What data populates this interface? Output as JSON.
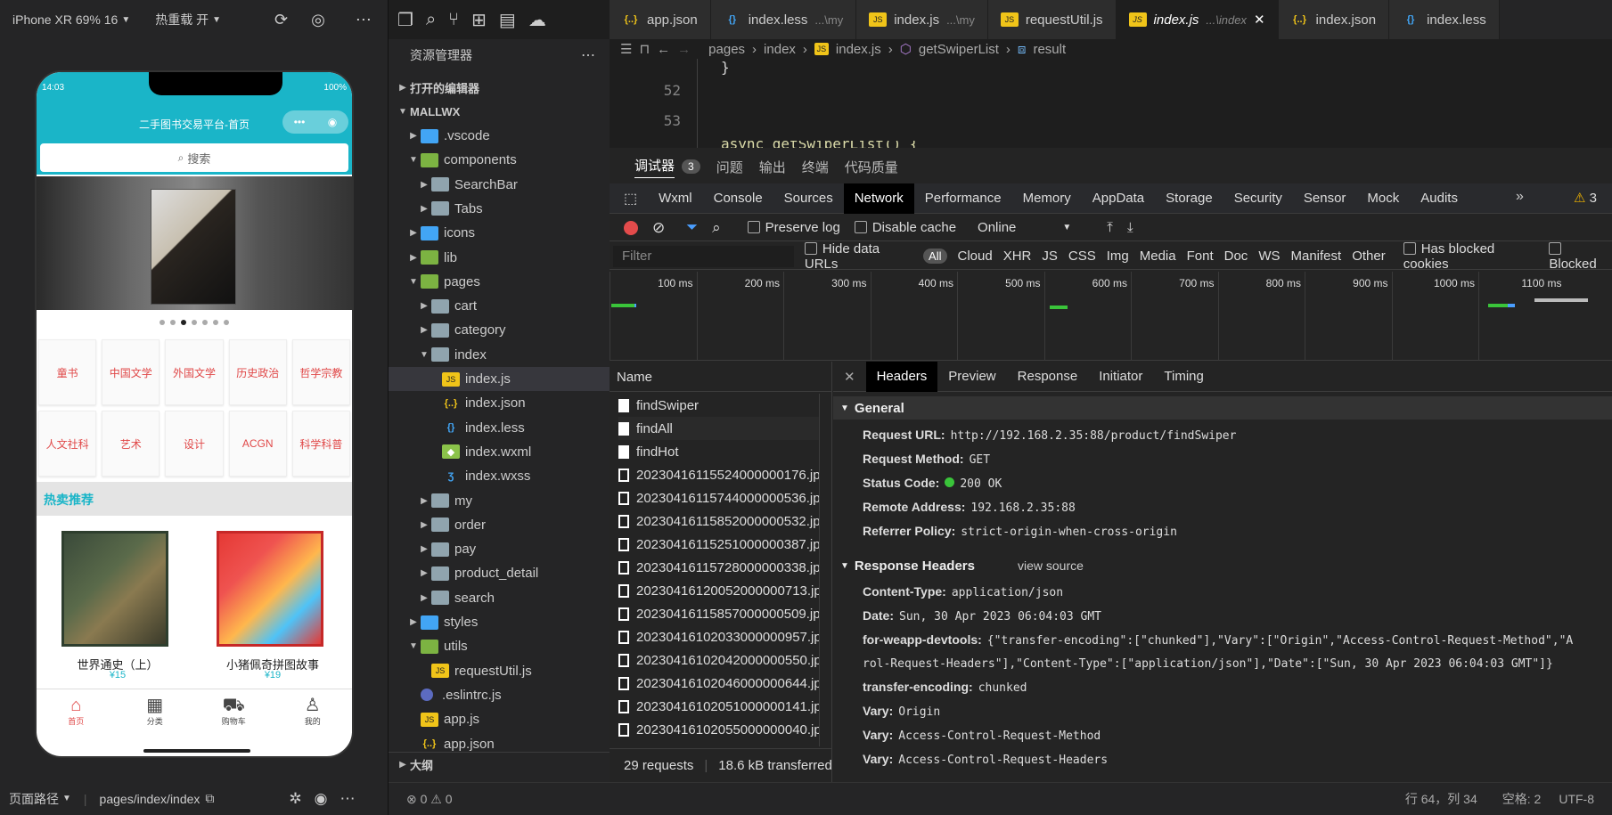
{
  "simulator": {
    "device": "iPhone XR 69% 16",
    "hot_reload": "热重载 开",
    "bottom": {
      "path_label": "页面路径",
      "path": "pages/index/index"
    },
    "phone": {
      "time": "14:03",
      "battery": "100%",
      "nav_title": "二手图书交易平台-首页",
      "capsule_more": "•••",
      "capsule_close": "◉",
      "search": "搜索",
      "swiper_dots": 7,
      "swiper_active_index": 3,
      "categories": [
        "童书",
        "中国文学",
        "外国文学",
        "历史政治",
        "哲学宗教",
        "人文社科",
        "艺术",
        "设计",
        "ACGN",
        "科学科普"
      ],
      "hot_title": "热卖推荐",
      "products": [
        {
          "name": "世界通史（上）",
          "price": "¥15"
        },
        {
          "name": "小猪佩奇拼图故事",
          "price": "¥19"
        }
      ],
      "tabbar": [
        {
          "label": "首页",
          "icon": "home-icon",
          "active": true
        },
        {
          "label": "分类",
          "icon": "category-icon",
          "active": false
        },
        {
          "label": "购物车",
          "icon": "cart-icon",
          "active": false
        },
        {
          "label": "我的",
          "icon": "user-icon",
          "active": false
        }
      ]
    }
  },
  "explorer": {
    "title": "资源管理器",
    "open_editors": "打开的编辑器",
    "project": "MALLWX",
    "outline": "大纲",
    "tree": [
      {
        "label": ".vscode",
        "type": "folder-bl",
        "depth": 1,
        "caret": "▶"
      },
      {
        "label": "components",
        "type": "folder-ac",
        "depth": 1,
        "caret": "▼"
      },
      {
        "label": "SearchBar",
        "type": "folder",
        "depth": 2,
        "caret": "▶"
      },
      {
        "label": "Tabs",
        "type": "folder",
        "depth": 2,
        "caret": "▶"
      },
      {
        "label": "icons",
        "type": "folder-bl",
        "depth": 1,
        "caret": "▶"
      },
      {
        "label": "lib",
        "type": "folder-ac",
        "depth": 1,
        "caret": "▶"
      },
      {
        "label": "pages",
        "type": "folder-ac",
        "depth": 1,
        "caret": "▼"
      },
      {
        "label": "cart",
        "type": "folder",
        "depth": 2,
        "caret": "▶"
      },
      {
        "label": "category",
        "type": "folder",
        "depth": 2,
        "caret": "▶"
      },
      {
        "label": "index",
        "type": "folder",
        "depth": 2,
        "caret": "▼"
      },
      {
        "label": "index.js",
        "type": "js",
        "depth": 3,
        "caret": "",
        "selected": true
      },
      {
        "label": "index.json",
        "type": "json",
        "depth": 3,
        "caret": ""
      },
      {
        "label": "index.less",
        "type": "less",
        "depth": 3,
        "caret": ""
      },
      {
        "label": "index.wxml",
        "type": "wxml",
        "depth": 3,
        "caret": ""
      },
      {
        "label": "index.wxss",
        "type": "wxss",
        "depth": 3,
        "caret": ""
      },
      {
        "label": "my",
        "type": "folder",
        "depth": 2,
        "caret": "▶"
      },
      {
        "label": "order",
        "type": "folder",
        "depth": 2,
        "caret": "▶"
      },
      {
        "label": "pay",
        "type": "folder",
        "depth": 2,
        "caret": "▶"
      },
      {
        "label": "product_detail",
        "type": "folder",
        "depth": 2,
        "caret": "▶"
      },
      {
        "label": "search",
        "type": "folder",
        "depth": 2,
        "caret": "▶"
      },
      {
        "label": "styles",
        "type": "folder-bl",
        "depth": 1,
        "caret": "▶"
      },
      {
        "label": "utils",
        "type": "folder-ac",
        "depth": 1,
        "caret": "▼"
      },
      {
        "label": "requestUtil.js",
        "type": "js",
        "depth": 2,
        "caret": ""
      },
      {
        "label": ".eslintrc.js",
        "type": "eslint",
        "depth": 1,
        "caret": ""
      },
      {
        "label": "app.js",
        "type": "js",
        "depth": 1,
        "caret": ""
      },
      {
        "label": "app.json",
        "type": "json",
        "depth": 1,
        "caret": ""
      }
    ]
  },
  "editor": {
    "tabs": [
      {
        "label": "app.json",
        "icon": "json",
        "hint": ""
      },
      {
        "label": "index.less",
        "icon": "less",
        "hint": "...\\my"
      },
      {
        "label": "index.js",
        "icon": "js",
        "hint": "...\\my"
      },
      {
        "label": "requestUtil.js",
        "icon": "js",
        "hint": ""
      },
      {
        "label": "index.js",
        "icon": "js",
        "hint": "...\\index",
        "active": true
      },
      {
        "label": "index.json",
        "icon": "json",
        "hint": ""
      },
      {
        "label": "index.less",
        "icon": "less",
        "hint": ""
      }
    ],
    "breadcrumb": [
      "pages",
      "index",
      "index.js",
      "getSwiperList",
      "result"
    ],
    "line_numbers": [
      "52",
      "53"
    ],
    "code_fragment": "async getSwiperList() {"
  },
  "devtools": {
    "panel_tabs": [
      "调试器",
      "问题",
      "输出",
      "终端",
      "代码质量"
    ],
    "debugger_badge": "3",
    "tabs": [
      "Wxml",
      "Console",
      "Sources",
      "Network",
      "Performance",
      "Memory",
      "AppData",
      "Storage",
      "Security",
      "Sensor",
      "Mock",
      "Audits"
    ],
    "active_tab": "Network",
    "warnings": "3",
    "toolbar": {
      "preserve_log": "Preserve log",
      "disable_cache": "Disable cache",
      "throttle": "Online"
    },
    "filter": {
      "placeholder": "Filter",
      "hide_data_urls": "Hide data URLs",
      "all": "All",
      "types": [
        "Cloud",
        "XHR",
        "JS",
        "CSS",
        "Img",
        "Media",
        "Font",
        "Doc",
        "WS",
        "Manifest",
        "Other"
      ],
      "blocked_cookies": "Has blocked cookies",
      "blocked": "Blocked"
    },
    "timeline_ticks": [
      "100 ms",
      "200 ms",
      "300 ms",
      "400 ms",
      "500 ms",
      "600 ms",
      "700 ms",
      "800 ms",
      "900 ms",
      "1000 ms",
      "1100 ms"
    ],
    "name_header": "Name",
    "requests": [
      {
        "name": "findSwiper",
        "kind": "doc"
      },
      {
        "name": "findAll",
        "kind": "doc"
      },
      {
        "name": "findHot",
        "kind": "doc"
      },
      {
        "name": "20230416115524000000176.jp",
        "kind": "img"
      },
      {
        "name": "20230416115744000000536.jp",
        "kind": "img"
      },
      {
        "name": "20230416115852000000532.jp",
        "kind": "img"
      },
      {
        "name": "20230416115251000000387.jp",
        "kind": "img"
      },
      {
        "name": "20230416115728000000338.jp",
        "kind": "img"
      },
      {
        "name": "20230416120052000000713.jp",
        "kind": "img"
      },
      {
        "name": "20230416115857000000509.jp",
        "kind": "img"
      },
      {
        "name": "20230416102033000000957.jp",
        "kind": "img"
      },
      {
        "name": "20230416102042000000550.jp",
        "kind": "img"
      },
      {
        "name": "20230416102046000000644.jp",
        "kind": "img"
      },
      {
        "name": "20230416102051000000141.jp",
        "kind": "img"
      },
      {
        "name": "20230416102055000000040.jp",
        "kind": "img"
      }
    ],
    "summary": {
      "requests": "29 requests",
      "transferred": "18.6 kB transferred"
    },
    "detail_tabs": [
      "Headers",
      "Preview",
      "Response",
      "Initiator",
      "Timing"
    ],
    "general": {
      "title": "General",
      "request_url_k": "Request URL:",
      "request_url": "http://192.168.2.35:88/product/findSwiper",
      "method_k": "Request Method:",
      "method": "GET",
      "status_k": "Status Code:",
      "status": "200 OK",
      "remote_k": "Remote Address:",
      "remote": "192.168.2.35:88",
      "referrer_k": "Referrer Policy:",
      "referrer": "strict-origin-when-cross-origin"
    },
    "response_headers": {
      "title": "Response Headers",
      "view_source": "view source",
      "content_type_k": "Content-Type:",
      "content_type": "application/json",
      "date_k": "Date:",
      "date": "Sun, 30 Apr 2023 06:04:03 GMT",
      "weapp_k": "for-weapp-devtools:",
      "weapp_1": "{\"transfer-encoding\":[\"chunked\"],\"Vary\":[\"Origin\",\"Access-Control-Request-Method\",\"A",
      "weapp_2": "rol-Request-Headers\"],\"Content-Type\":[\"application/json\"],\"Date\":[\"Sun, 30 Apr 2023 06:04:03 GMT\"]}",
      "te_k": "transfer-encoding:",
      "te": "chunked",
      "vary1_k": "Vary:",
      "vary1": "Origin",
      "vary2_k": "Vary:",
      "vary2": "Access-Control-Request-Method",
      "vary3_k": "Vary:",
      "vary3": "Access-Control-Request-Headers"
    }
  },
  "statusbar": {
    "errors": "⊗ 0 ⚠ 0",
    "position": "行 64，列 34",
    "indent": "空格: 2",
    "encoding": "UTF-8"
  }
}
